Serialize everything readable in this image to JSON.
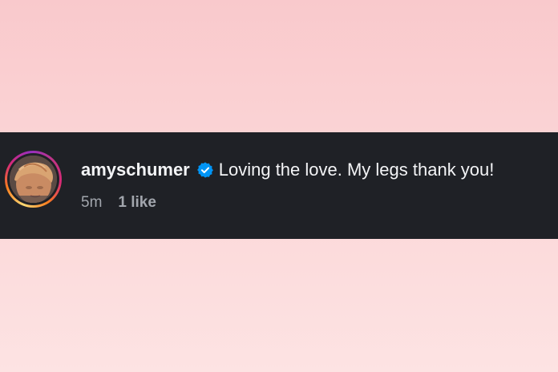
{
  "comment": {
    "username": "amyschumer",
    "verified_icon": "verified-badge-icon",
    "text": "Loving the love. My legs thank you!",
    "time": "5m",
    "likes": "1 like"
  },
  "colors": {
    "background_top": "#f9c9cc",
    "background_bottom": "#fde3e3",
    "bar": "#1f2126",
    "primary_text": "#f3f4f6",
    "secondary_text": "#a2a6ad",
    "verified_blue": "#0095f6"
  }
}
